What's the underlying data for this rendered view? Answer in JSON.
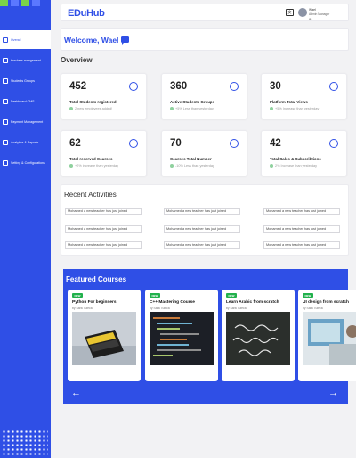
{
  "brand": {
    "logo_text": "EDuHub",
    "primary": "#2f4fe6",
    "green": "#1fae3d"
  },
  "sidebar": {
    "items": [
      {
        "label": "Overall",
        "icon": "grid-icon",
        "active": true
      },
      {
        "label": "teachers mangement",
        "icon": "teacher-icon"
      },
      {
        "label": "Students Groups",
        "icon": "group-icon"
      },
      {
        "label": "Dashboard CMS",
        "icon": "cms-icon"
      },
      {
        "label": "Payment Management",
        "icon": "payment-icon"
      },
      {
        "label": "Analytics & Reports",
        "icon": "chart-icon"
      },
      {
        "label": "Setting & Configurations",
        "icon": "gear-icon"
      }
    ]
  },
  "header": {
    "user_name": "Wael",
    "user_role": "Admin Manager",
    "user_extra": "ab"
  },
  "welcome": {
    "text": "Welcome, Wael"
  },
  "overview": {
    "title": "Overview",
    "stats": [
      {
        "value": "452",
        "label": "Total Students registered",
        "sub": "2 new employees added!",
        "icon": "users-icon"
      },
      {
        "value": "360",
        "label": "Active Students Groups",
        "sub": "+5% Less than yesterday",
        "icon": "group-icon"
      },
      {
        "value": "30",
        "label": "Platform Total Views",
        "sub": "+5% Increase than yesterday",
        "icon": "cloud-icon"
      },
      {
        "value": "62",
        "label": "Total  reserved Courses",
        "sub": "+2% increase than yesterday",
        "icon": "clock-icon"
      },
      {
        "value": "70",
        "label": "Courses Total Number",
        "sub": "-10% Less than yesterday",
        "icon": "moon-icon"
      },
      {
        "value": "42",
        "label": "Total Sales & Subscribtions",
        "sub": "2% Increase than yesterday",
        "icon": "document-icon"
      }
    ]
  },
  "activities": {
    "title": "Recent Activities",
    "items": [
      "Mohamed a new teacher has just joined",
      "Mohamed a new teacher has just joined",
      "Mohamed a new teacher has just joined",
      "Mohamed a new teacher has just joined",
      "Mohamed a new teacher has just joined",
      "Mohamed a new teacher has just joined",
      "Mohamed a new teacher has just joined",
      "Mohamed a new teacher has just joined",
      "Mohamed a new teacher has just joined"
    ]
  },
  "featured": {
    "title": "Featured Courses",
    "courses": [
      {
        "badge": "NEW",
        "title": "Python For beginners",
        "by": "by Sara Tuleca"
      },
      {
        "badge": "NEW",
        "title": "C++ Mastering Course",
        "by": "by Sara Tuleca"
      },
      {
        "badge": "NEW",
        "title": "Learn Arabic from scratch",
        "by": "by Sara Tuleca"
      },
      {
        "badge": "NEW",
        "title": "UI design from scratch",
        "by": "by Sara Tuleca"
      }
    ],
    "prev_icon": "←",
    "next_icon": "→"
  }
}
